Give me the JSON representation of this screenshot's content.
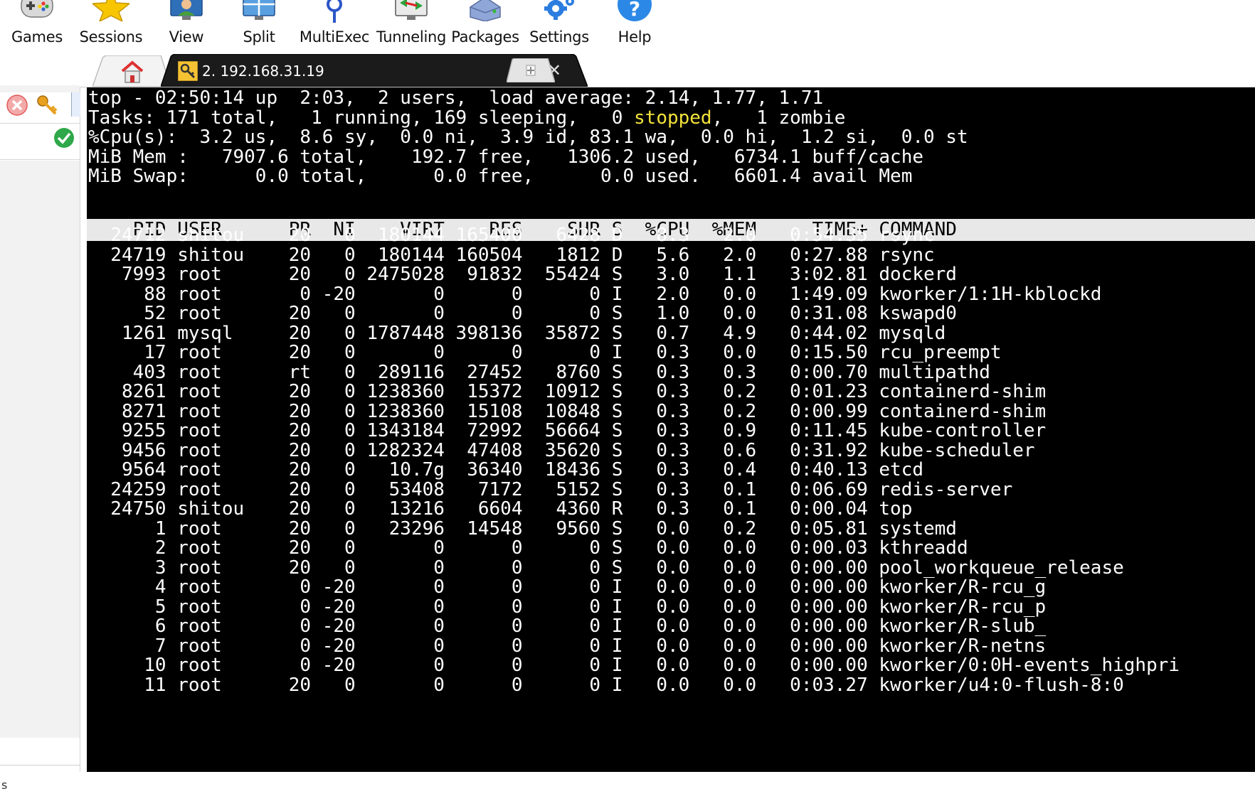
{
  "toolbar": {
    "buttons": [
      {
        "label": "Games",
        "icon": "gamepad-icon"
      },
      {
        "label": "Sessions",
        "icon": "star-icon"
      },
      {
        "label": "View",
        "icon": "monitor-user-icon"
      },
      {
        "label": "Split",
        "icon": "split-screen-icon"
      },
      {
        "label": "MultiExec",
        "icon": "fork-icon"
      },
      {
        "label": "Tunneling",
        "icon": "tunnel-icon"
      },
      {
        "label": "Packages",
        "icon": "package-icon"
      },
      {
        "label": "Settings",
        "icon": "gear-icon"
      },
      {
        "label": "Help",
        "icon": "help-icon"
      }
    ]
  },
  "sidebar": {
    "bottom_text": "s"
  },
  "tabs": {
    "home_icon": "home-icon",
    "active_label": "2. 192.168.31.19",
    "active_icon": "key-icon",
    "close_glyph": "✕"
  },
  "colors": {
    "terminal_bg": "#000000",
    "terminal_fg": "#ffffff",
    "highlight": "#f3e23b",
    "header_bar": "#e8e8e8",
    "tab_active": "#1b1b1b"
  },
  "terminal": {
    "summary": [
      "top - 02:50:14 up  2:03,  2 users,  load average: 2.14, 1.77, 1.71",
      "%Cpu(s):  3.2 us,  8.6 sy,  0.0 ni,  3.9 id, 83.1 wa,  0.0 hi,  1.2 si,  0.0 st",
      "MiB Mem :   7907.6 total,    192.7 free,   1306.2 used,   6734.1 buff/cache",
      "MiB Swap:      0.0 total,      0.0 free,      0.0 used.   6601.4 avail Mem"
    ],
    "tasks_line": {
      "before": "Tasks: 171 total,   1 running, 169 sleeping,   0 ",
      "highlight": "stopped",
      "after": ",   1 zombie"
    },
    "column_header": "    PID USER      PR  NI    VIRT    RES    SHR S  %CPU  %MEM     TIME+ COMMAND",
    "processes": [
      "  24712 shitou    20   0  180144 165400   6428 D   8.3   2.0   0:54.35 rsync",
      "  24719 shitou    20   0  180144 160504   1812 D   5.6   2.0   0:27.88 rsync",
      "   7993 root      20   0 2475028  91832  55424 S   3.0   1.1   3:02.81 dockerd",
      "     88 root       0 -20       0      0      0 I   2.0   0.0   1:49.09 kworker/1:1H-kblockd",
      "     52 root      20   0       0      0      0 S   1.0   0.0   0:31.08 kswapd0",
      "   1261 mysql     20   0 1787448 398136  35872 S   0.7   4.9   0:44.02 mysqld",
      "     17 root      20   0       0      0      0 I   0.3   0.0   0:15.50 rcu_preempt",
      "    403 root      rt   0  289116  27452   8760 S   0.3   0.3   0:00.70 multipathd",
      "   8261 root      20   0 1238360  15372  10912 S   0.3   0.2   0:01.23 containerd-shim",
      "   8271 root      20   0 1238360  15108  10848 S   0.3   0.2   0:00.99 containerd-shim",
      "   9255 root      20   0 1343184  72992  56664 S   0.3   0.9   0:11.45 kube-controller",
      "   9456 root      20   0 1282324  47408  35620 S   0.3   0.6   0:31.92 kube-scheduler",
      "   9564 root      20   0   10.7g  36340  18436 S   0.3   0.4   0:40.13 etcd",
      "  24259 root      20   0   53408   7172   5152 S   0.3   0.1   0:06.69 redis-server",
      "  24750 shitou    20   0   13216   6604   4360 R   0.3   0.1   0:00.04 top",
      "      1 root      20   0   23296  14548   9560 S   0.0   0.2   0:05.81 systemd",
      "      2 root      20   0       0      0      0 S   0.0   0.0   0:00.03 kthreadd",
      "      3 root      20   0       0      0      0 S   0.0   0.0   0:00.00 pool_workqueue_release",
      "      4 root       0 -20       0      0      0 I   0.0   0.0   0:00.00 kworker/R-rcu_g",
      "      5 root       0 -20       0      0      0 I   0.0   0.0   0:00.00 kworker/R-rcu_p",
      "      6 root       0 -20       0      0      0 I   0.0   0.0   0:00.00 kworker/R-slub_",
      "      7 root       0 -20       0      0      0 I   0.0   0.0   0:00.00 kworker/R-netns",
      "     10 root       0 -20       0      0      0 I   0.0   0.0   0:00.00 kworker/0:0H-events_highpri",
      "     11 root      20   0       0      0      0 I   0.0   0.0   0:03.27 kworker/u4:0-flush-8:0"
    ]
  }
}
